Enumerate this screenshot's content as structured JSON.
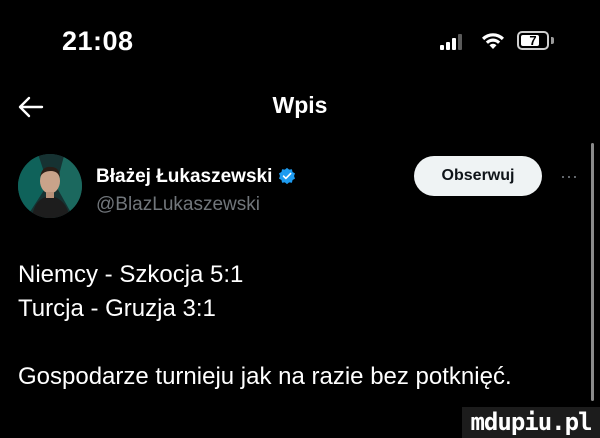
{
  "status_bar": {
    "time": "21:08",
    "battery_level": "7",
    "signal_icon": "signal-bars-icon",
    "wifi_icon": "wifi-icon",
    "battery_icon": "battery-icon"
  },
  "nav": {
    "back_icon": "arrow-left-icon",
    "title": "Wpis"
  },
  "author": {
    "display_name": "Błażej Łukaszewski",
    "handle": "@BlazLukaszewski",
    "verified_icon": "verified-badge-icon",
    "verified_color": "#1d9bf0",
    "follow_label": "Obserwuj",
    "more_icon": "more-dots-icon",
    "more_label": "···"
  },
  "tweet": {
    "lines": [
      "Niemcy - Szkocja 5:1",
      "Turcja - Gruzja 3:1",
      "",
      "Gospodarze turnieju jak na razie bez potknięć."
    ]
  },
  "watermark": {
    "text": "mdupiu.pl"
  },
  "colors": {
    "background": "#000000",
    "text_primary": "#ffffff",
    "text_secondary": "#71767b",
    "follow_button_bg": "#eff3f4"
  }
}
